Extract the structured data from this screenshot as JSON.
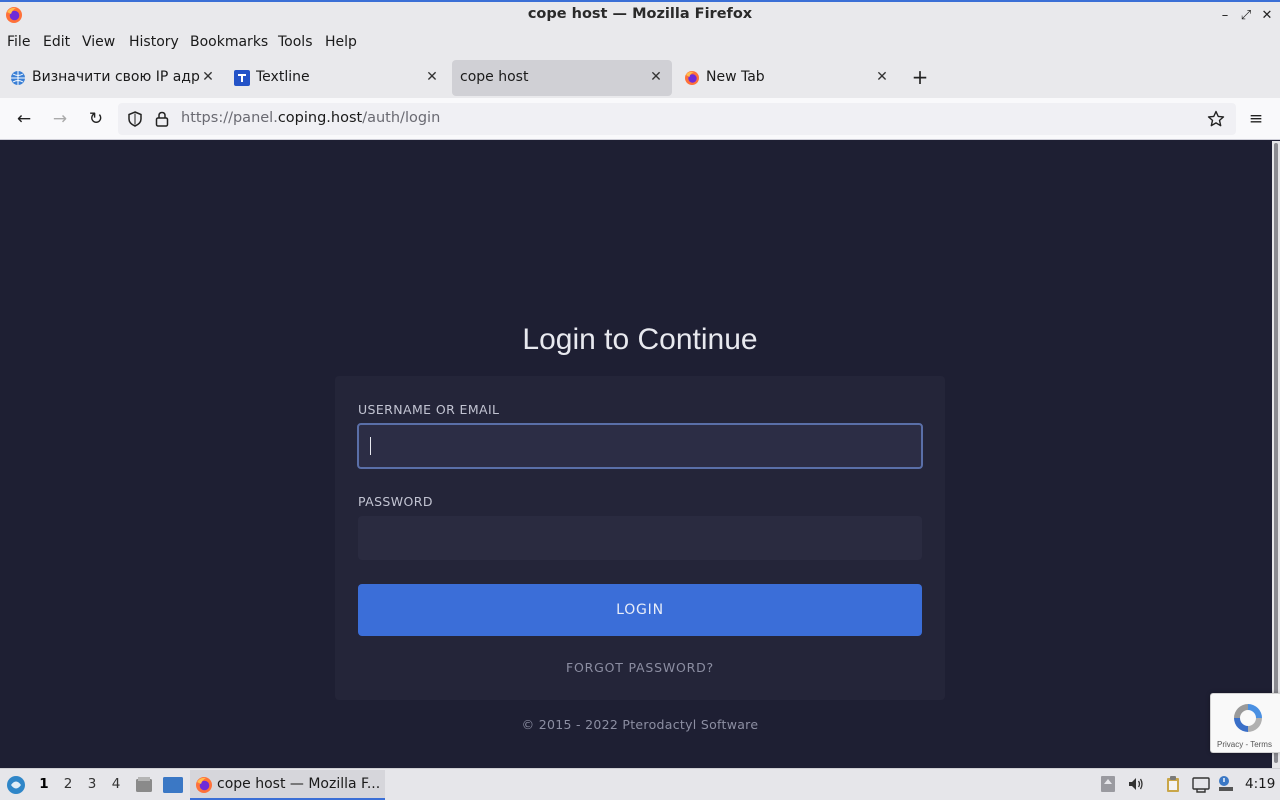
{
  "window": {
    "title": "cope host — Mozilla Firefox"
  },
  "menu": [
    "File",
    "Edit",
    "View",
    "History",
    "Bookmarks",
    "Tools",
    "Help"
  ],
  "tabs": [
    {
      "label": "Визначити свою IP адре",
      "icon": "globe-icon"
    },
    {
      "label": "Textline",
      "icon": "textline-icon"
    },
    {
      "label": "cope host",
      "icon": "",
      "active": true
    },
    {
      "label": "New Tab",
      "icon": "firefox-icon"
    }
  ],
  "url": {
    "prefix": "https://panel.",
    "host": "coping.host",
    "path": "/auth/login"
  },
  "page": {
    "title": "Login to Continue",
    "username_label": "USERNAME OR EMAIL",
    "username_value": "",
    "password_label": "PASSWORD",
    "password_value": "",
    "login_button": "LOGIN",
    "forgot_link": "FORGOT PASSWORD?",
    "copyright": "© 2015 - 2022 Pterodactyl Software"
  },
  "recaptcha": {
    "links": "Privacy - Terms"
  },
  "taskbar": {
    "workspaces": [
      "1",
      "2",
      "3",
      "4"
    ],
    "active_workspace": "1",
    "task_label": "cope host — Mozilla F...",
    "clock": "4:19"
  },
  "colors": {
    "accent": "#3b6ed8",
    "page_bg": "#1e1f33",
    "card_bg": "#242539"
  }
}
